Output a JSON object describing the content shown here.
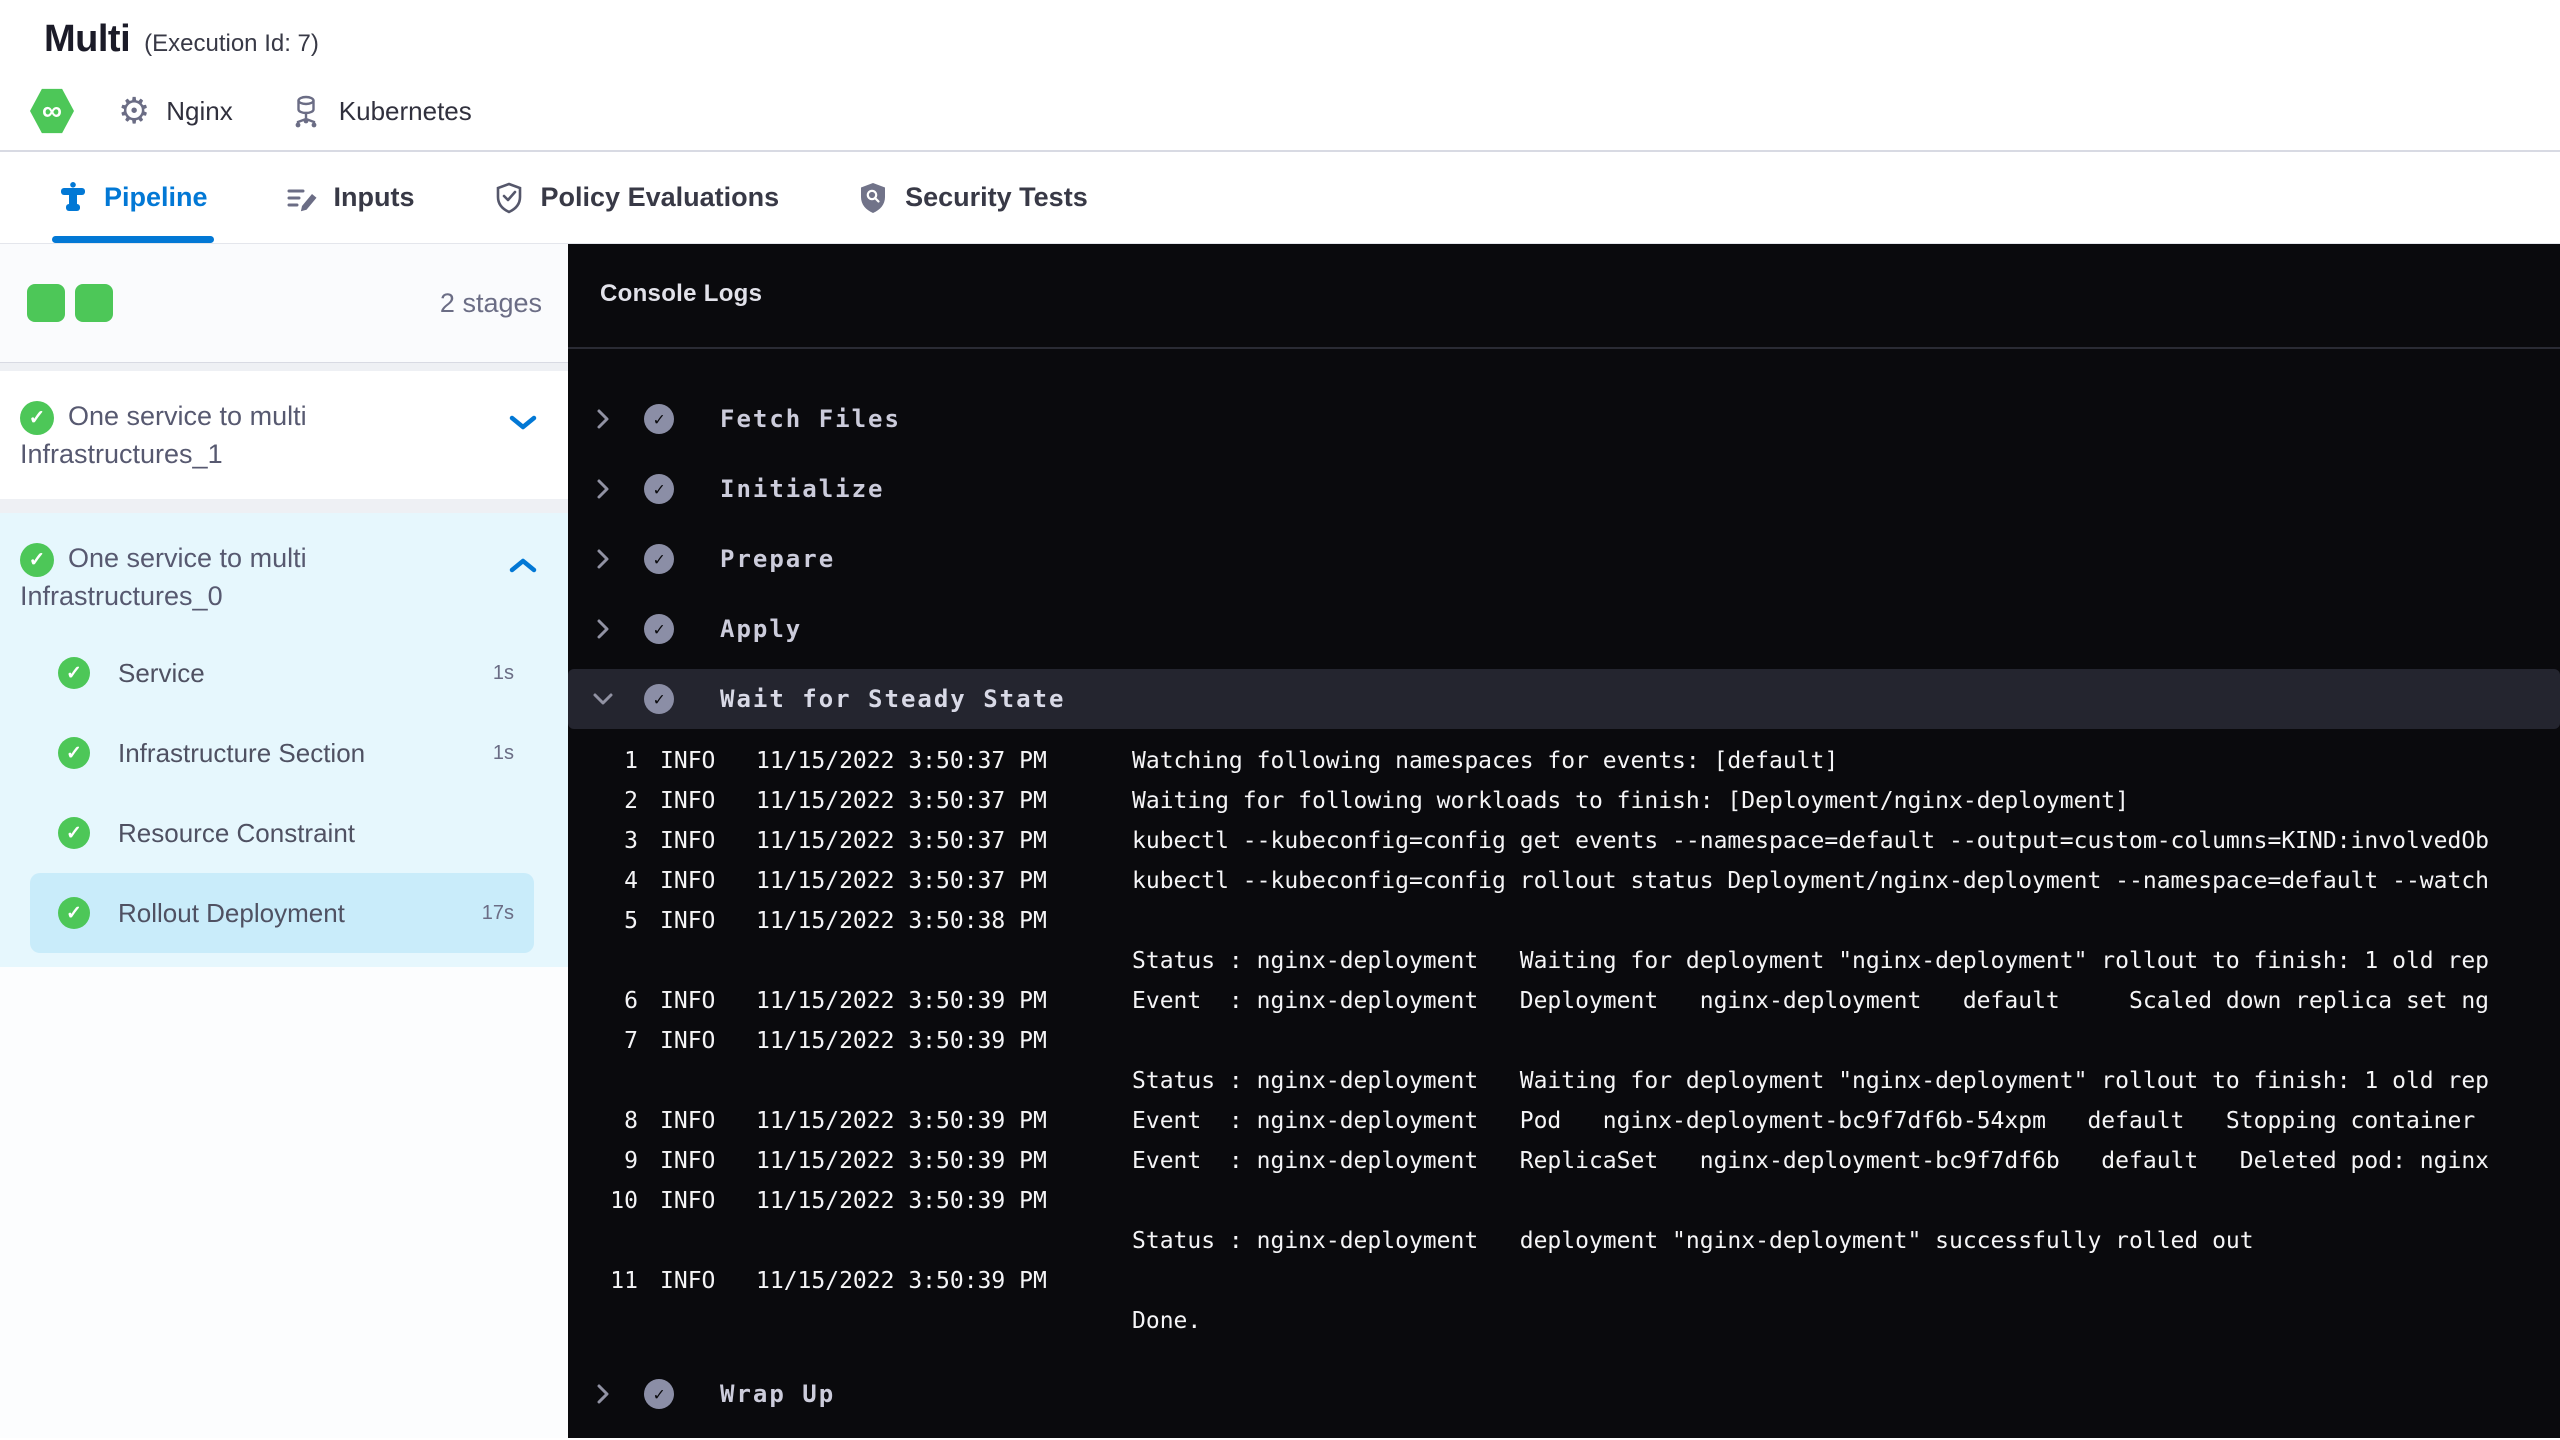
{
  "header": {
    "title": "Multi",
    "execution_id": "(Execution Id: 7)",
    "service_label": "Nginx",
    "environment_label": "Kubernetes",
    "module_icon": "harness-cd-hexagon-infinity"
  },
  "tabs": [
    {
      "label": "Pipeline",
      "active": true
    },
    {
      "label": "Inputs",
      "active": false
    },
    {
      "label": "Policy Evaluations",
      "active": false
    },
    {
      "label": "Security Tests",
      "active": false
    }
  ],
  "sidebar": {
    "stage_count": "2 stages",
    "stages": [
      {
        "label": "One service to multi Infrastructures_1",
        "status": "success",
        "expanded": false
      },
      {
        "label": "One service to multi Infrastructures_0",
        "status": "success",
        "expanded": true
      }
    ],
    "substeps": [
      {
        "label": "Service",
        "duration": "1s",
        "status": "success",
        "selected": false
      },
      {
        "label": "Infrastructure Section",
        "duration": "1s",
        "status": "success",
        "selected": false
      },
      {
        "label": "Resource Constraint",
        "duration": "",
        "status": "success",
        "selected": false
      },
      {
        "label": "Rollout Deployment",
        "duration": "17s",
        "status": "success",
        "selected": true
      }
    ]
  },
  "console": {
    "title": "Console Logs",
    "steps": [
      {
        "label": "Fetch Files",
        "status": "success",
        "expanded": false
      },
      {
        "label": "Initialize",
        "status": "success",
        "expanded": false
      },
      {
        "label": "Prepare",
        "status": "success",
        "expanded": false
      },
      {
        "label": "Apply",
        "status": "success",
        "expanded": false
      },
      {
        "label": "Wait for Steady State",
        "status": "success",
        "expanded": true
      },
      {
        "label": "Wrap Up",
        "status": "success",
        "expanded": false
      }
    ],
    "logs": [
      {
        "num": "1",
        "level": "INFO",
        "time": "11/15/2022 3:50:37 PM",
        "msg": "Watching following namespaces for events: [default]"
      },
      {
        "num": "2",
        "level": "INFO",
        "time": "11/15/2022 3:50:37 PM",
        "msg": "Waiting for following workloads to finish: [Deployment/nginx-deployment]"
      },
      {
        "num": "3",
        "level": "INFO",
        "time": "11/15/2022 3:50:37 PM",
        "msg": "kubectl --kubeconfig=config get events --namespace=default --output=custom-columns=KIND:involvedOb"
      },
      {
        "num": "4",
        "level": "INFO",
        "time": "11/15/2022 3:50:37 PM",
        "msg": "kubectl --kubeconfig=config rollout status Deployment/nginx-deployment --namespace=default --watch"
      },
      {
        "num": "5",
        "level": "INFO",
        "time": "11/15/2022 3:50:38 PM",
        "msg": ""
      },
      {
        "num": "",
        "level": "",
        "time": "",
        "msg": "Status : nginx-deployment   Waiting for deployment \"nginx-deployment\" rollout to finish: 1 old rep"
      },
      {
        "num": "6",
        "level": "INFO",
        "time": "11/15/2022 3:50:39 PM",
        "msg": "Event  : nginx-deployment   Deployment   nginx-deployment   default     Scaled down replica set ng"
      },
      {
        "num": "7",
        "level": "INFO",
        "time": "11/15/2022 3:50:39 PM",
        "msg": ""
      },
      {
        "num": "",
        "level": "",
        "time": "",
        "msg": "Status : nginx-deployment   Waiting for deployment \"nginx-deployment\" rollout to finish: 1 old rep"
      },
      {
        "num": "8",
        "level": "INFO",
        "time": "11/15/2022 3:50:39 PM",
        "msg": "Event  : nginx-deployment   Pod   nginx-deployment-bc9f7df6b-54xpm   default   Stopping container"
      },
      {
        "num": "9",
        "level": "INFO",
        "time": "11/15/2022 3:50:39 PM",
        "msg": "Event  : nginx-deployment   ReplicaSet   nginx-deployment-bc9f7df6b   default   Deleted pod: nginx"
      },
      {
        "num": "10",
        "level": "INFO",
        "time": "11/15/2022 3:50:39 PM",
        "msg": ""
      },
      {
        "num": "",
        "level": "",
        "time": "",
        "msg": "Status : nginx-deployment   deployment \"nginx-deployment\" successfully rolled out"
      },
      {
        "num": "11",
        "level": "INFO",
        "time": "11/15/2022 3:50:39 PM",
        "msg": ""
      },
      {
        "num": "",
        "level": "",
        "time": "",
        "msg": "Done."
      }
    ]
  },
  "colors": {
    "accent_blue": "#0278d5",
    "success_green": "#4dc758",
    "selected_step_bg": "#c9ecfa",
    "expanded_stage_bg": "#e6f7fd",
    "console_bg": "#0a0a0d",
    "console_selected_row": "#24252f"
  }
}
